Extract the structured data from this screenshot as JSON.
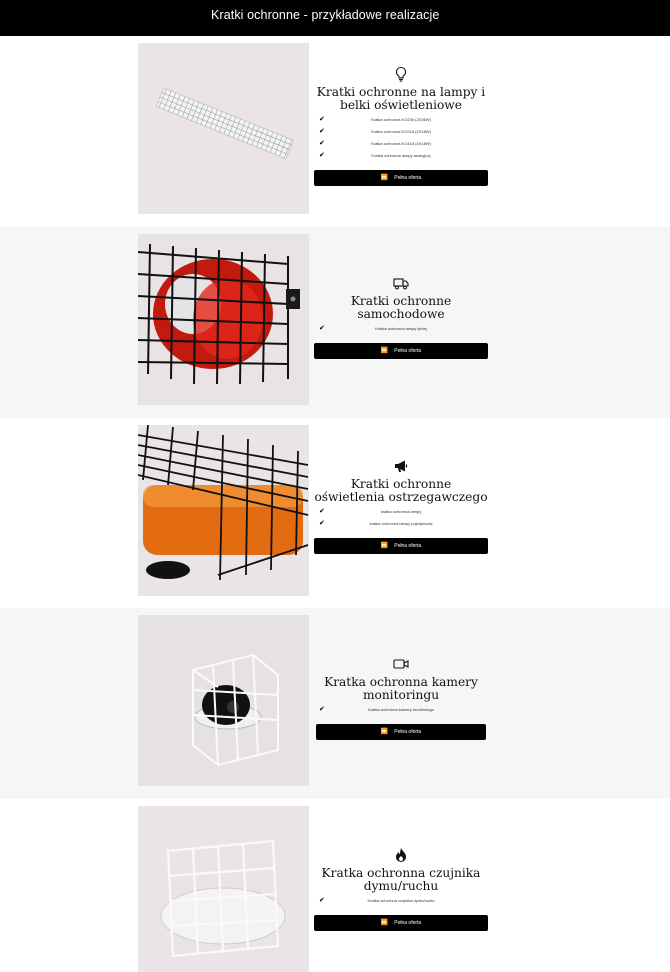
{
  "header": {
    "title": "Kratki ochronne - przykładowe realizacje"
  },
  "sections": [
    {
      "icon": "lightbulb-icon",
      "title": "Kratki ochronne na lampy i belki oświetleniowe",
      "items": [
        "Kratka ochronna KO236 (2X36W)",
        "Kratka ochronna KO218 (2X18W)",
        "Kratka ochronna KO418 (4X18W)",
        "Kratka ochronna lampy awaryjnej"
      ],
      "button": "Pełna oferta"
    },
    {
      "icon": "truck-icon",
      "title": "Kratki ochronne samochodowe",
      "items": [
        "Kratka ochronna lampy tylnej"
      ],
      "button": "Pełna oferta"
    },
    {
      "icon": "megaphone-icon",
      "title": "Kratki ochronne oświetlenia ostrzegawczego",
      "items": [
        "kratka ochronna lampy "
      ],
      "items_extra": [
        "kratka ochronna lampy pojedynczej"
      ],
      "button": "Pełna oferta"
    },
    {
      "icon": "video-camera-icon",
      "title": "Kratka ochronna kamery monitoringu",
      "items": [
        "Kratka ochronna kamery monitoringu"
      ],
      "button": "Pełna oferta"
    },
    {
      "icon": "fire-icon",
      "title": "Kratka ochronna czujnika dymu/ruchu",
      "items": [
        "Kratka ochronna czujnika dymu/ruchu"
      ],
      "button": "Pełna oferta"
    }
  ]
}
